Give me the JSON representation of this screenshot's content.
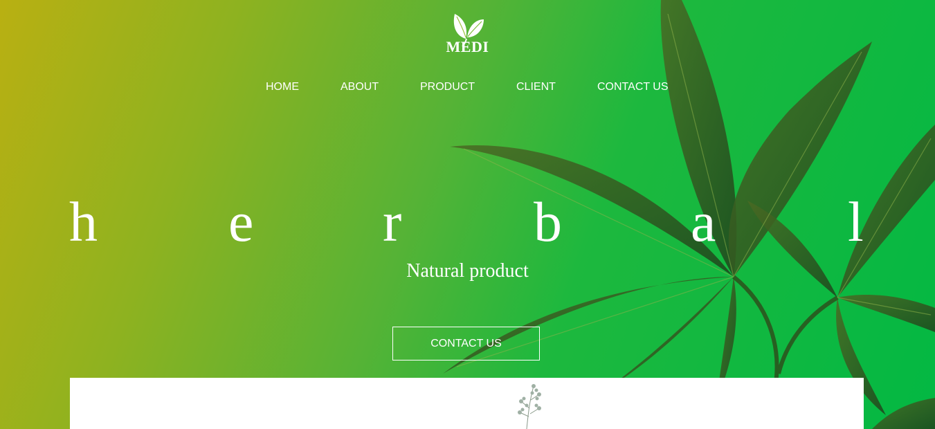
{
  "brand": {
    "name": "MEDI",
    "logo_icon": "leaf-logo-icon"
  },
  "nav": {
    "items": [
      {
        "label": "HOME"
      },
      {
        "label": "ABOUT"
      },
      {
        "label": "PRODUCT"
      },
      {
        "label": "CLIENT"
      },
      {
        "label": "CONTACT US"
      }
    ]
  },
  "hero": {
    "letters": [
      "h",
      "e",
      "r",
      "b",
      "a",
      "l"
    ],
    "subtitle": "Natural product",
    "cta_label": "CONTACT US"
  },
  "colors": {
    "gradient_start": "#b9b012",
    "gradient_end": "#03b843",
    "leaf_dark": "#2f5a1c",
    "text": "#ffffff"
  }
}
